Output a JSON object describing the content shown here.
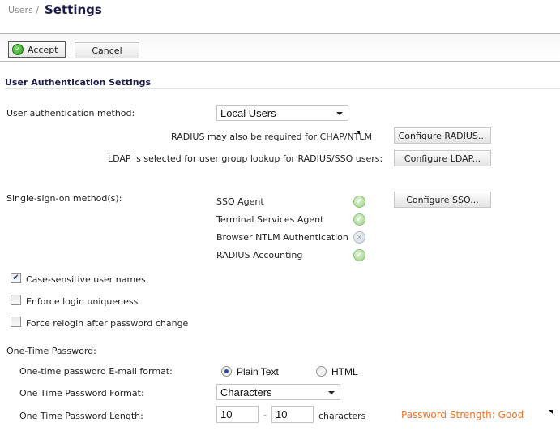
{
  "header": {
    "breadcrumb": "Users /",
    "title": "Settings"
  },
  "toolbar": {
    "accept_label": "Accept",
    "cancel_label": "Cancel"
  },
  "section": {
    "title": "User Authentication Settings"
  },
  "auth": {
    "method_label": "User authentication method:",
    "method_value": "Local Users",
    "radius_note": "RADIUS may also be required for CHAP/NTLM",
    "ldap_note": "LDAP is selected for user group lookup for RADIUS/SSO users:",
    "configure_radius": "Configure RADIUS...",
    "configure_ldap": "Configure LDAP..."
  },
  "sso": {
    "label": "Single-sign-on method(s):",
    "configure_sso": "Configure SSO...",
    "methods": [
      {
        "name": "SSO Agent",
        "status": "enabled"
      },
      {
        "name": "Terminal Services Agent",
        "status": "enabled"
      },
      {
        "name": "Browser NTLM Authentication",
        "status": "disabled"
      },
      {
        "name": "RADIUS Accounting",
        "status": "enabled"
      }
    ]
  },
  "options": [
    {
      "label": "Case-sensitive user names",
      "checked": true
    },
    {
      "label": "Enforce login uniqueness",
      "checked": false
    },
    {
      "label": "Force relogin after password change",
      "checked": false
    }
  ],
  "otp": {
    "heading": "One-Time Password:",
    "email_format_label": "One-time password E-mail format:",
    "email_format_options": [
      {
        "label": "Plain Text",
        "selected": true
      },
      {
        "label": "HTML",
        "selected": false
      }
    ],
    "format_label": "One Time Password Format:",
    "format_value": "Characters",
    "length_label": "One Time Password Length:",
    "length_min": "10",
    "length_separator": "-",
    "length_max": "10",
    "length_unit": "characters",
    "strength": "Password Strength: Good"
  },
  "colors": {
    "title": "#1c1c4a",
    "strength": "#f0772b",
    "ok_status": "#9fd18b",
    "accept_icon": "#2e9a23"
  }
}
